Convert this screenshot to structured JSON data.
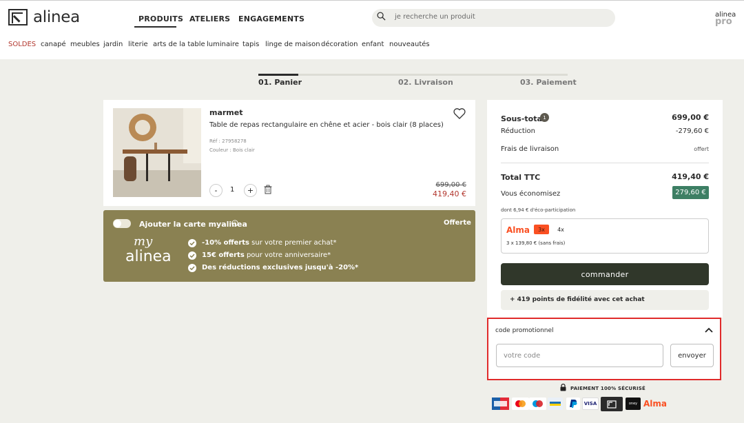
{
  "header": {
    "logo": "alinea",
    "nav": [
      "PRODUITS",
      "ATELIERS",
      "ENGAGEMENTS"
    ],
    "search_placeholder": "je recherche un produit",
    "pro_logo_top": "alinea",
    "pro_logo_bottom": "pro",
    "categories": [
      "SOLDES",
      "canapé",
      "meubles",
      "jardin",
      "literie",
      "arts de la table",
      "luminaire",
      "tapis",
      "linge de maison",
      "décoration",
      "enfant",
      "nouveautés"
    ]
  },
  "steps": [
    "01. Panier",
    "02. Livraison",
    "03. Paiement"
  ],
  "product": {
    "brand": "marmet",
    "description": "Table de repas rectangulaire en chêne et acier - bois clair (8 places)",
    "ref": "Réf : 27958278",
    "color": "Couleur : Bois clair",
    "quantity": "1",
    "qty_minus": "-",
    "qty_plus": "+",
    "old_price": "699,00 €",
    "price": "419,40 €"
  },
  "loyalty": {
    "title": "Ajouter la carte myalinea",
    "tag": "Offerte",
    "logo_my": "my",
    "logo_alinea": "alinea",
    "benefits": [
      {
        "bold": "-10% offerts",
        "rest": " sur votre premier achat*"
      },
      {
        "bold": "15€ offerts",
        "rest": " pour votre anniversaire*"
      },
      {
        "bold": "Des réductions exclusives jusqu'à -20%*",
        "rest": ""
      }
    ]
  },
  "summary": {
    "subtotal_label": "Sous-total",
    "subtotal_badge": "1",
    "subtotal_value": "699,00 €",
    "discount_label": "Réduction",
    "discount_value": "-279,60 €",
    "shipping_label": "Frais de livraison",
    "shipping_value": "offert",
    "total_label": "Total TTC",
    "total_value": "419,40 €",
    "save_label": "Vous économisez",
    "save_value": "279,60 €",
    "eco_note": "dont 6,94 € d'éco-participation",
    "alma_brand": "Alma",
    "alma_opt1": "3x",
    "alma_opt2": "4x",
    "alma_detail": "3 x 139,80 € (sans frais)",
    "order_button": "commander",
    "points": "+ 419 points de fidélité avec cet achat"
  },
  "promo": {
    "title": "code promotionnel",
    "placeholder": "votre code",
    "button": "envoyer"
  },
  "secure": {
    "label": "PAIEMENT 100% SÉCURISÉ",
    "payments": [
      "CB",
      "Mastercard",
      "Maestro",
      "Bancontact",
      "PayPal",
      "VISA",
      "alinea",
      "Oney",
      "Alma"
    ],
    "visa": "VISA",
    "oney": "oney",
    "alma": "Alma"
  },
  "colors": {
    "accent_dark": "#30372a",
    "loyalty_bg": "#8a8152",
    "save_badge": "#3d7f64",
    "price_red": "#b2362d",
    "promo_border": "#e02a2a",
    "alma_red": "#fa5022"
  }
}
